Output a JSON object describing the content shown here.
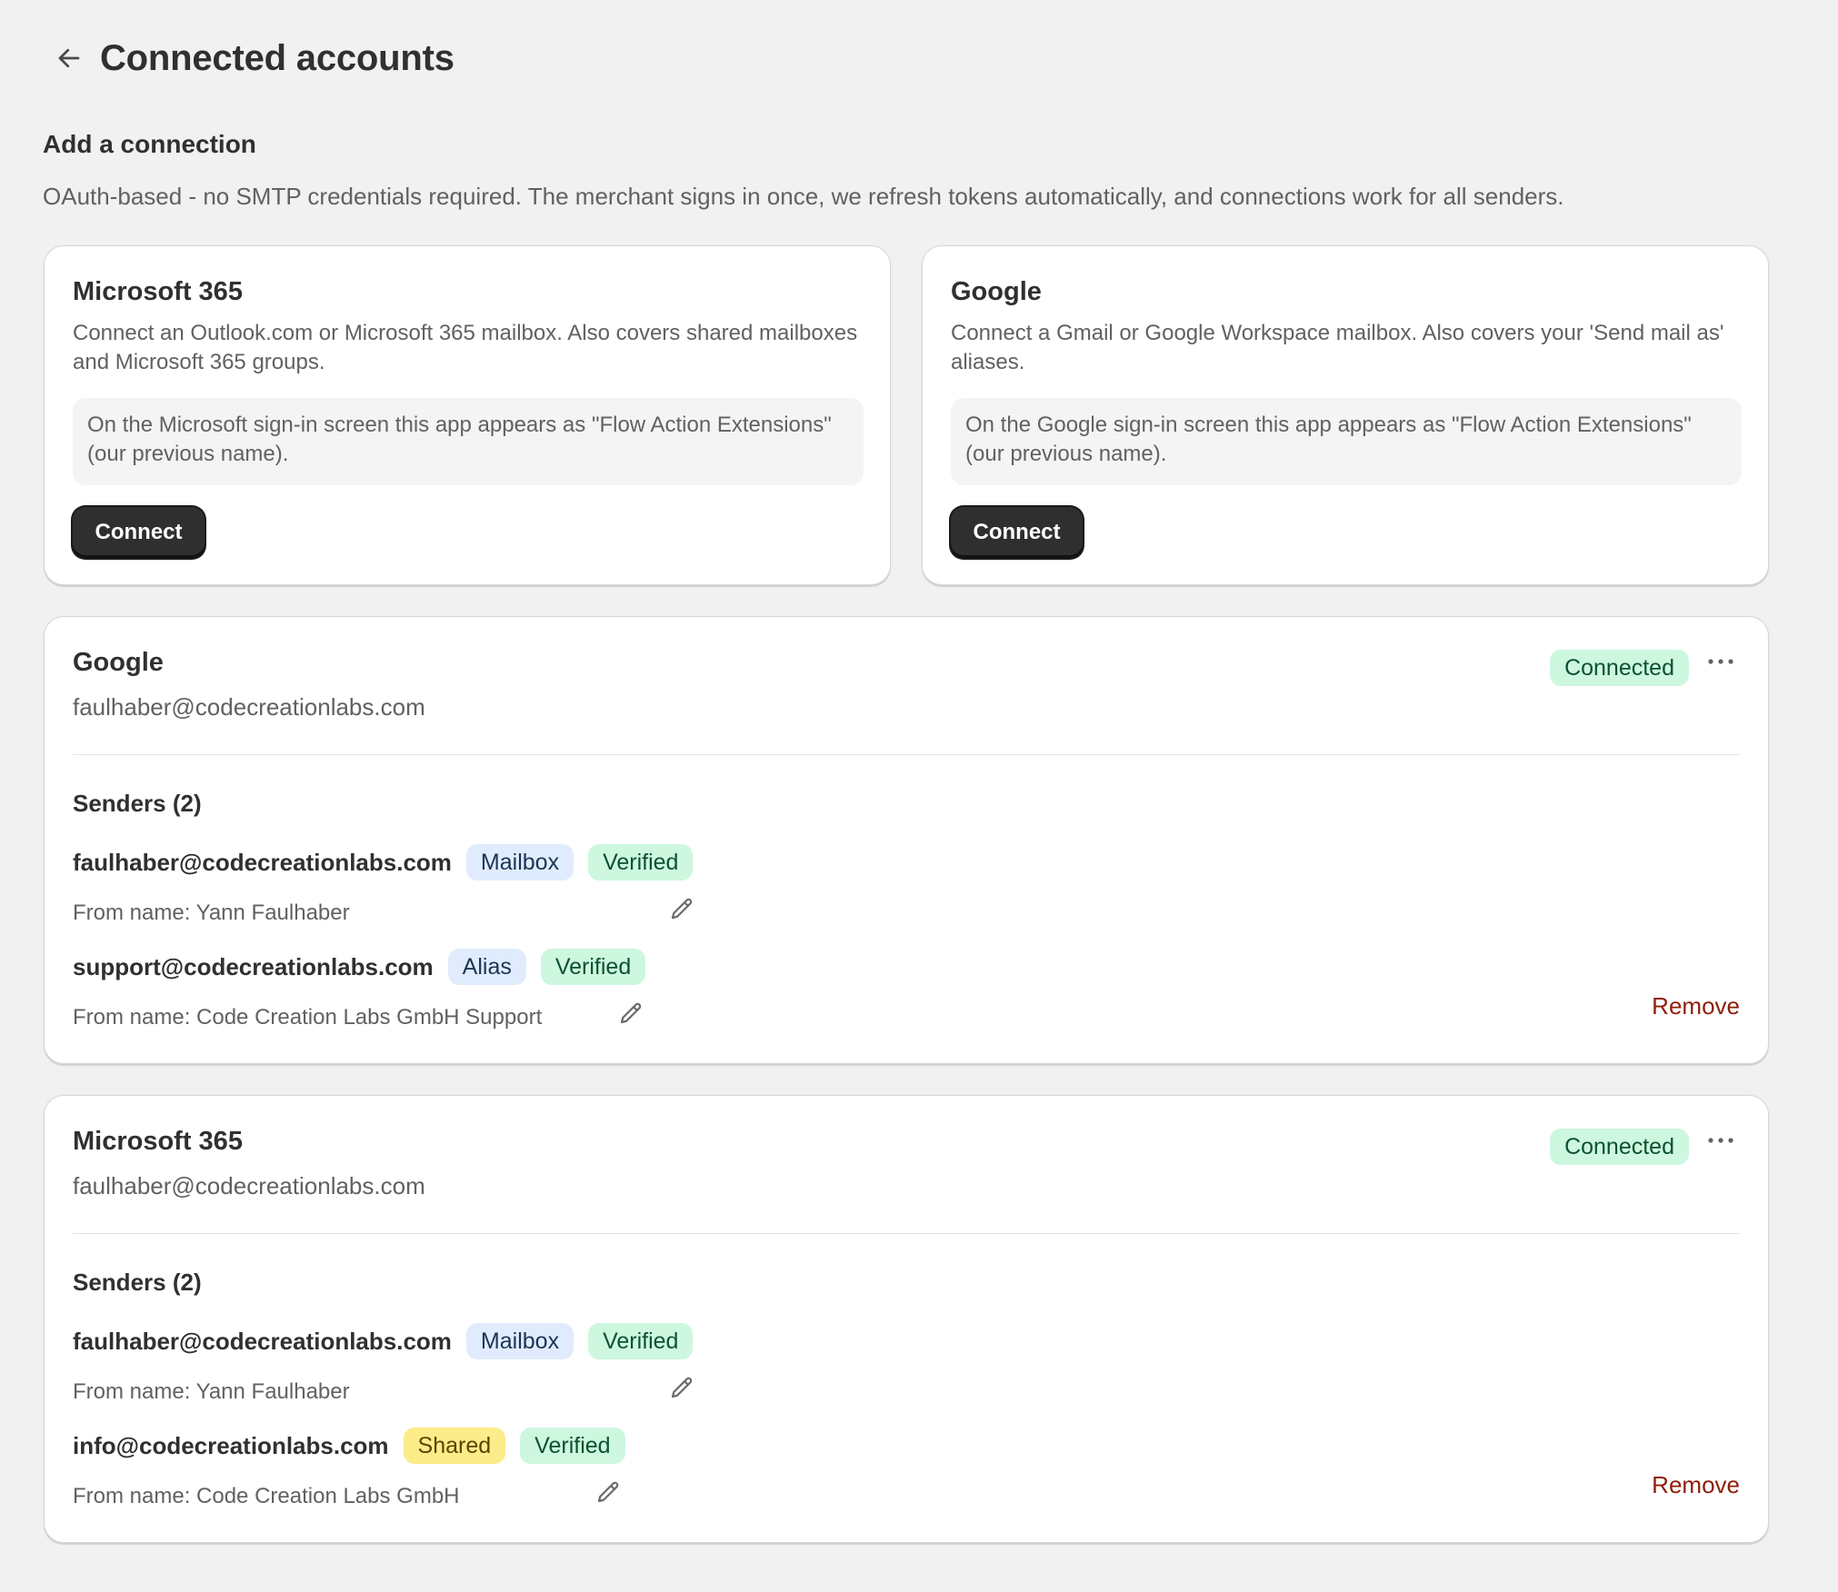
{
  "header": {
    "title": "Connected accounts",
    "back_icon": "arrow-left-icon"
  },
  "add_connection": {
    "heading": "Add a connection",
    "description": "OAuth-based - no SMTP credentials required. The merchant signs in once, we refresh tokens automatically, and connections work for all senders."
  },
  "providers": [
    {
      "title": "Microsoft 365",
      "description": "Connect an Outlook.com or Microsoft 365 mailbox. Also covers shared mailboxes and Microsoft 365 groups.",
      "note": "On the Microsoft sign-in screen this app appears as \"Flow Action Extensions\" (our previous name).",
      "button_label": "Connect"
    },
    {
      "title": "Google",
      "description": "Connect a Gmail or Google Workspace mailbox. Also covers your 'Send mail as' aliases.",
      "note": "On the Google sign-in screen this app appears as \"Flow Action Extensions\" (our previous name).",
      "button_label": "Connect"
    }
  ],
  "accounts": [
    {
      "provider": "Google",
      "email": "faulhaber@codecreationlabs.com",
      "status": "Connected",
      "senders_title": "Senders (2)",
      "remove_label": "Remove",
      "senders": [
        {
          "email": "faulhaber@codecreationlabs.com",
          "type_tag": "Mailbox",
          "verified_tag": "Verified",
          "from_name": "From name: Yann Faulhaber"
        },
        {
          "email": "support@codecreationlabs.com",
          "type_tag": "Alias",
          "verified_tag": "Verified",
          "from_name": "From name: Code Creation Labs GmbH Support"
        }
      ]
    },
    {
      "provider": "Microsoft 365",
      "email": "faulhaber@codecreationlabs.com",
      "status": "Connected",
      "senders_title": "Senders (2)",
      "remove_label": "Remove",
      "senders": [
        {
          "email": "faulhaber@codecreationlabs.com",
          "type_tag": "Mailbox",
          "verified_tag": "Verified",
          "from_name": "From name: Yann Faulhaber"
        },
        {
          "email": "info@codecreationlabs.com",
          "type_tag": "Shared",
          "verified_tag": "Verified",
          "from_name": "From name: Code Creation Labs GmbH"
        }
      ]
    }
  ],
  "colors": {
    "page_bg": "#f1f1f1",
    "card_bg": "#ffffff",
    "primary_button": "#2f2f2f",
    "connected_badge_bg": "#cdf7de",
    "mailbox_tag_bg": "#e0ecfd",
    "shared_tag_bg": "#fcec8a",
    "remove_link": "#8e1f0b"
  },
  "icons": {
    "more": "more-horizontal-icon",
    "edit": "pencil-icon"
  }
}
